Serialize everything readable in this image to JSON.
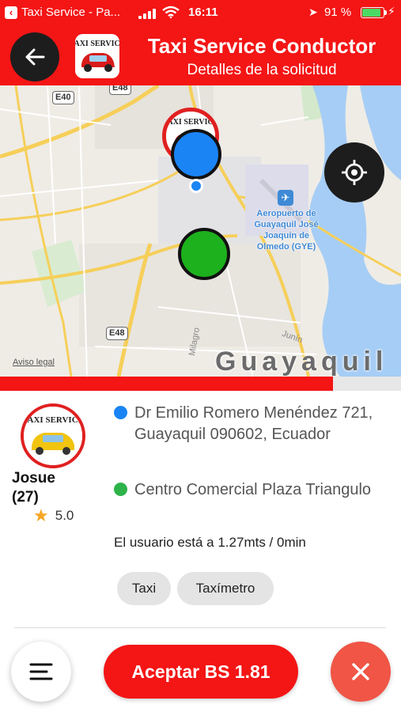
{
  "status_bar": {
    "app_name": "Taxi Service - Pa...",
    "time": "16:11",
    "battery_percent": "91 %",
    "battery_level": 0.91
  },
  "header": {
    "title": "Taxi Service Conductor",
    "subtitle": "Detalles de la solicitud"
  },
  "map": {
    "road_labels": [
      "E40",
      "E48",
      "E48"
    ],
    "airport_label": "Aeropuerto de Guayaquil José Joaquín de Olmedo (GYE)",
    "city_label": "Guayaquil",
    "street_labels": [
      "Milagro",
      "Junín"
    ],
    "legal_link": "Aviso legal",
    "logo_text": "TAXI SERVICE"
  },
  "progress": {
    "value": 0.83
  },
  "driver": {
    "name": "Josue",
    "count": "(27)",
    "rating": "5.0",
    "avatar_logo_text": "TAXI SERVICE"
  },
  "trip": {
    "origin": "Dr Emilio Romero Menéndez 721, Guayaquil 090602, Ecuador",
    "destination": "Centro Comercial Plaza Triangulo",
    "eta_text": "El usuario está a 1.27mts / 0min"
  },
  "chips": [
    "Taxi",
    "Taxímetro"
  ],
  "actions": {
    "accept_label": "Aceptar BS 1.81"
  },
  "colors": {
    "brand_red": "#f41515",
    "origin_blue": "#1b84f5",
    "destination_green": "#1db11d",
    "close_red": "#f05545"
  }
}
